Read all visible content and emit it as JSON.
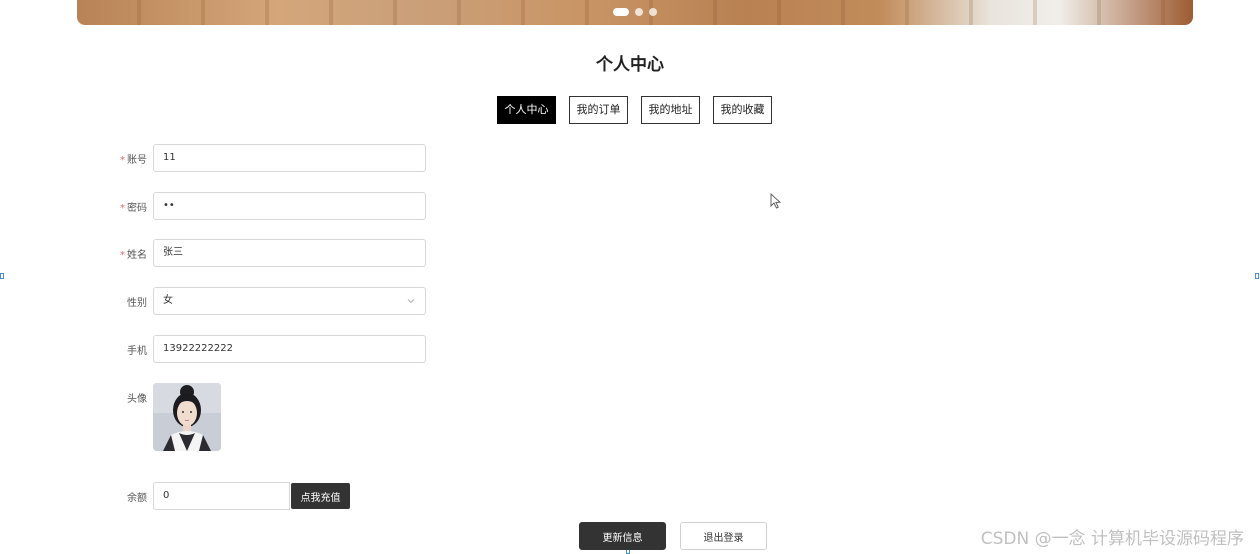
{
  "banner": {
    "slides": 3,
    "active_slide": 0
  },
  "page_title": "个人中心",
  "tabs": [
    {
      "label": "个人中心",
      "active": true
    },
    {
      "label": "我的订单",
      "active": false
    },
    {
      "label": "我的地址",
      "active": false
    },
    {
      "label": "我的收藏",
      "active": false
    }
  ],
  "form": {
    "account": {
      "label": "账号",
      "required": true,
      "value": "11"
    },
    "password": {
      "label": "密码",
      "required": true,
      "value": "••"
    },
    "name": {
      "label": "姓名",
      "required": true,
      "value": "张三"
    },
    "gender": {
      "label": "性别",
      "required": false,
      "value": "女"
    },
    "phone": {
      "label": "手机",
      "required": false,
      "value": "13922222222"
    },
    "avatar": {
      "label": "头像",
      "required": false
    },
    "balance": {
      "label": "余额",
      "required": false,
      "value": "0",
      "recharge_label": "点我充值"
    }
  },
  "actions": {
    "update_label": "更新信息",
    "logout_label": "退出登录"
  },
  "watermark": "CSDN @一念 计算机毕设源码程序",
  "colors": {
    "accent": "#333333",
    "active_tab": "#000000",
    "required": "#e86a6a"
  }
}
